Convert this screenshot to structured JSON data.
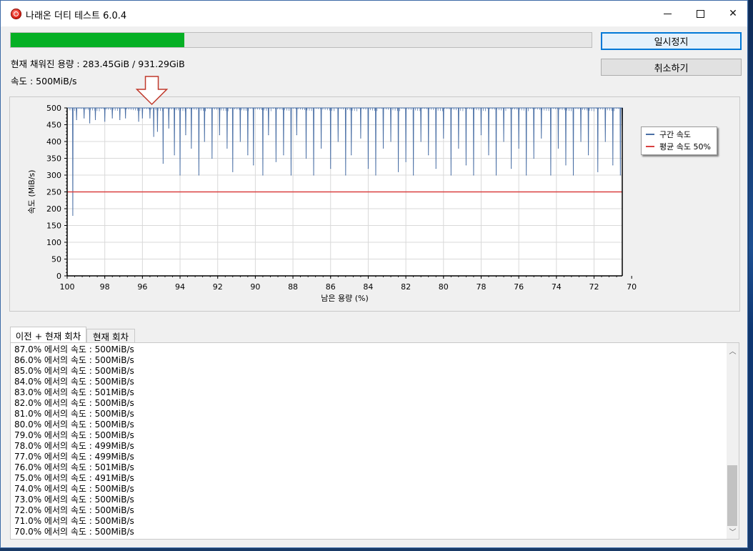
{
  "window": {
    "title": "나래온 더티 테스트 6.0.4",
    "controls": {
      "minimize_icon": "minimize-icon",
      "maximize_icon": "maximize-icon",
      "close_icon": "close-icon",
      "close_glyph": "✕"
    }
  },
  "progress": {
    "fraction": 0.299,
    "color": "#06b025"
  },
  "buttons": {
    "pause": "일시정지",
    "cancel": "취소하기"
  },
  "status": {
    "filled": "현재 채워진 용량 : 283.45GiB / 931.29GiB",
    "speed": "속도 : 500MiB/s"
  },
  "chart_data": {
    "type": "line",
    "xlabel": "남은 용량 (%)",
    "ylabel": "속도 (MiB/s)",
    "xlim": [
      100,
      70.5
    ],
    "ylim": [
      0,
      500
    ],
    "x_ticks": [
      "100",
      "98",
      "96",
      "94",
      "92",
      "90",
      "88",
      "86",
      "84",
      "82",
      "80",
      "78",
      "76",
      "74",
      "72",
      "70"
    ],
    "y_ticks": [
      "500",
      "450",
      "400",
      "350",
      "300",
      "250",
      "200",
      "150",
      "100",
      "50",
      "0"
    ],
    "grid": true,
    "legend_position": "right",
    "marker_arrow_x": 95.5,
    "series": [
      {
        "name": "구간 속도",
        "color": "#4a6fa5",
        "baseline": 500,
        "dips": [
          [
            99.7,
            180
          ],
          [
            99.5,
            465
          ],
          [
            99.1,
            470
          ],
          [
            98.8,
            455
          ],
          [
            98.5,
            465
          ],
          [
            98.0,
            460
          ],
          [
            97.6,
            470
          ],
          [
            97.2,
            465
          ],
          [
            96.9,
            470
          ],
          [
            96.2,
            460
          ],
          [
            96.0,
            470
          ],
          [
            95.6,
            470
          ],
          [
            95.4,
            415
          ],
          [
            95.2,
            430
          ],
          [
            94.9,
            335
          ],
          [
            94.6,
            440
          ],
          [
            94.3,
            360
          ],
          [
            94.0,
            300
          ],
          [
            93.7,
            420
          ],
          [
            93.4,
            380
          ],
          [
            93.0,
            300
          ],
          [
            92.7,
            400
          ],
          [
            92.3,
            350
          ],
          [
            91.9,
            420
          ],
          [
            91.5,
            380
          ],
          [
            91.2,
            310
          ],
          [
            90.8,
            400
          ],
          [
            90.4,
            360
          ],
          [
            90.1,
            330
          ],
          [
            89.6,
            300
          ],
          [
            89.3,
            420
          ],
          [
            88.9,
            340
          ],
          [
            88.5,
            360
          ],
          [
            88.1,
            300
          ],
          [
            87.8,
            420
          ],
          [
            87.3,
            350
          ],
          [
            86.9,
            300
          ],
          [
            86.5,
            380
          ],
          [
            86.0,
            320
          ],
          [
            85.6,
            400
          ],
          [
            85.2,
            300
          ],
          [
            84.9,
            360
          ],
          [
            84.4,
            410
          ],
          [
            84.0,
            320
          ],
          [
            83.6,
            300
          ],
          [
            83.2,
            380
          ],
          [
            82.8,
            400
          ],
          [
            82.4,
            310
          ],
          [
            82.0,
            340
          ],
          [
            81.6,
            300
          ],
          [
            81.2,
            400
          ],
          [
            80.8,
            360
          ],
          [
            80.4,
            320
          ],
          [
            80.0,
            410
          ],
          [
            79.6,
            300
          ],
          [
            79.2,
            380
          ],
          [
            78.8,
            330
          ],
          [
            78.4,
            300
          ],
          [
            78.0,
            420
          ],
          [
            77.6,
            360
          ],
          [
            77.2,
            300
          ],
          [
            76.8,
            400
          ],
          [
            76.4,
            320
          ],
          [
            76.0,
            380
          ],
          [
            75.6,
            300
          ],
          [
            75.2,
            350
          ],
          [
            74.8,
            410
          ],
          [
            74.3,
            300
          ],
          [
            73.9,
            380
          ],
          [
            73.5,
            330
          ],
          [
            73.1,
            300
          ],
          [
            72.7,
            400
          ],
          [
            72.3,
            360
          ],
          [
            71.8,
            310
          ],
          [
            71.4,
            400
          ],
          [
            71.0,
            330
          ],
          [
            70.6,
            300
          ],
          [
            70.5,
            430
          ]
        ]
      },
      {
        "name": "평균 속도 50%",
        "color": "#d94040",
        "values": [
          [
            100,
            250
          ],
          [
            70.5,
            250
          ]
        ]
      }
    ]
  },
  "tabs": [
    "이전 + 현재 회차",
    "현재 회차"
  ],
  "log": [
    "87.0% 에서의 속도 : 500MiB/s",
    "86.0% 에서의 속도 : 500MiB/s",
    "85.0% 에서의 속도 : 500MiB/s",
    "84.0% 에서의 속도 : 500MiB/s",
    "83.0% 에서의 속도 : 501MiB/s",
    "82.0% 에서의 속도 : 500MiB/s",
    "81.0% 에서의 속도 : 500MiB/s",
    "80.0% 에서의 속도 : 500MiB/s",
    "79.0% 에서의 속도 : 500MiB/s",
    "78.0% 에서의 속도 : 499MiB/s",
    "77.0% 에서의 속도 : 499MiB/s",
    "76.0% 에서의 속도 : 501MiB/s",
    "75.0% 에서의 속도 : 491MiB/s",
    "74.0% 에서의 속도 : 500MiB/s",
    "73.0% 에서의 속도 : 500MiB/s",
    "72.0% 에서의 속도 : 500MiB/s",
    "71.0% 에서의 속도 : 500MiB/s",
    "70.0% 에서의 속도 : 500MiB/s"
  ]
}
